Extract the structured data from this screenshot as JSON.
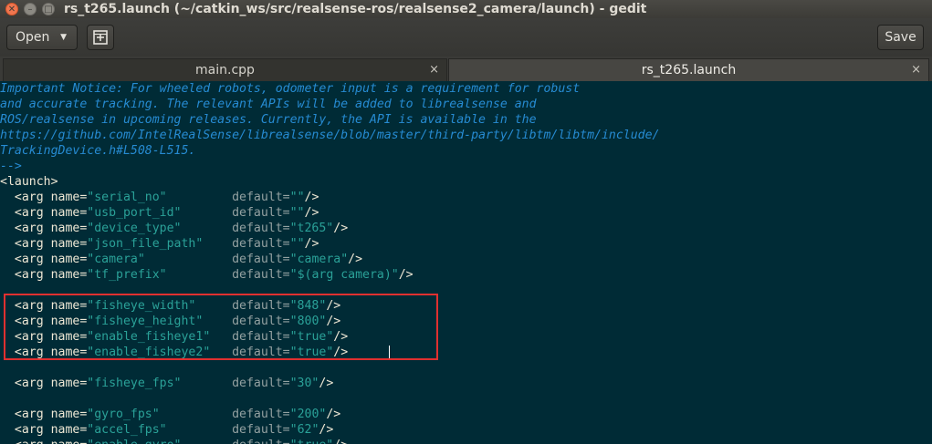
{
  "window": {
    "title": "rs_t265.launch (~/catkin_ws/src/realsense-ros/realsense2_camera/launch) - gedit",
    "close_glyph": "✕",
    "min_glyph": "–",
    "max_glyph": "□"
  },
  "toolbar": {
    "open_label": "Open",
    "open_arrow": "▼",
    "new_tab_glyph": "⊞",
    "save_label": "Save"
  },
  "tabs": [
    {
      "label": "main.cpp",
      "close": "×",
      "active": false
    },
    {
      "label": "rs_t265.launch",
      "close": "×",
      "active": true
    }
  ],
  "editor": {
    "comment_lines": [
      "Important Notice: For wheeled robots, odometer input is a requirement for robust",
      "and accurate tracking. The relevant APIs will be added to librealsense and",
      "ROS/realsense in upcoming releases. Currently, the API is available in the",
      "https://github.com/IntelRealSense/librealsense/blob/master/third-party/libtm/libtm/include/",
      "TrackingDevice.h#L508-L515.",
      "-->"
    ],
    "launch_open": "<launch>",
    "arg_prefix": "  <arg name=",
    "default_attr": "default=",
    "args": [
      {
        "name": "\"serial_no\"",
        "default": "\"\"",
        "close": "/>"
      },
      {
        "name": "\"usb_port_id\"",
        "default": "\"\"",
        "close": "/>"
      },
      {
        "name": "\"device_type\"",
        "default": "\"t265\"",
        "close": "/>"
      },
      {
        "name": "\"json_file_path\"",
        "default": "\"\"",
        "close": "/>"
      },
      {
        "name": "\"camera\"",
        "default": "\"camera\"",
        "close": "/>"
      },
      {
        "name": "\"tf_prefix\"",
        "default": "\"$(arg camera)\"",
        "close": "/>"
      },
      {
        "blank": true
      },
      {
        "name": "\"fisheye_width\"",
        "default": "\"848\"",
        "close": "/>"
      },
      {
        "name": "\"fisheye_height\"",
        "default": "\"800\"",
        "close": "/>"
      },
      {
        "name": "\"enable_fisheye1\"",
        "default": "\"true\"",
        "close": "/>"
      },
      {
        "name": "\"enable_fisheye2\"",
        "default": "\"true\"",
        "close": "/>"
      },
      {
        "blank": true
      },
      {
        "name": "\"fisheye_fps\"",
        "default": "\"30\"",
        "close": "/>"
      },
      {
        "blank": true
      },
      {
        "name": "\"gyro_fps\"",
        "default": "\"200\"",
        "close": "/>"
      },
      {
        "name": "\"accel_fps\"",
        "default": "\"62\"",
        "close": "/>"
      },
      {
        "name": "\"enable_gyro\"",
        "default": "\"true\"",
        "close": "/>"
      }
    ]
  },
  "colors": {
    "editor_bg": "#002b36",
    "comment": "#268bd2",
    "string": "#2aa198",
    "highlight_box": "#e03030"
  }
}
